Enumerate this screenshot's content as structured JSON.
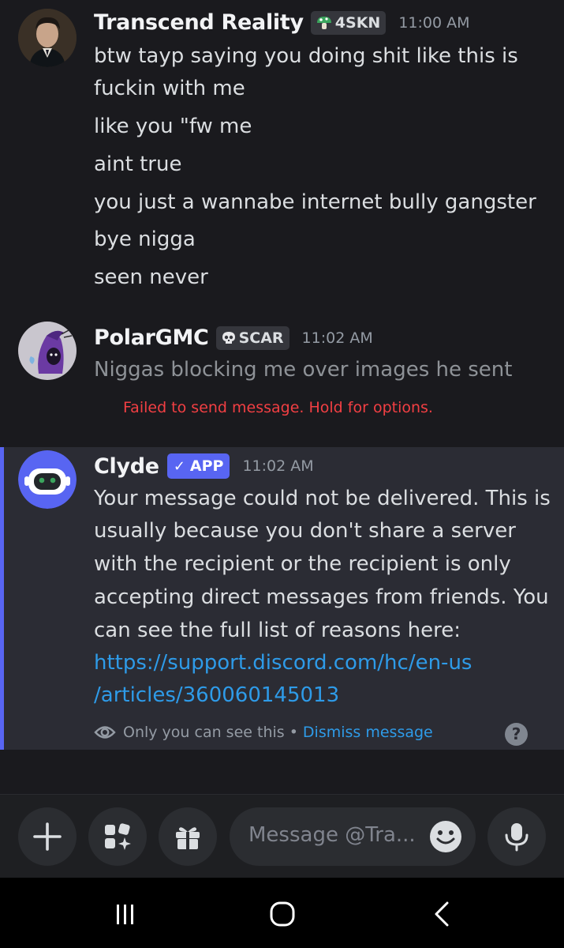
{
  "messages": [
    {
      "username": "Transcend Reality",
      "tag": "4SKN",
      "time": "11:00 AM",
      "lines": [
        "btw tayp saying you doing shit like this is",
        "fuckin with me",
        "like you \"fw me",
        "aint true",
        "you just a wannabe internet bully gangster",
        "bye nigga",
        "seen never"
      ]
    },
    {
      "username": "PolarGMC",
      "tag": "SCAR",
      "time": "11:02 AM",
      "lines": [
        "Niggas blocking me over images he sent"
      ],
      "error": "Failed to send message. Hold for options."
    }
  ],
  "clyde": {
    "username": "Clyde",
    "tag": "APP",
    "time": "11:02 AM",
    "lines": [
      "Your message could not be delivered. This is",
      "usually because you don't share a server",
      "with the recipient or the recipient is only",
      "accepting direct messages from friends. You",
      "can see the full list of reasons here:"
    ],
    "link_lines": [
      "https://support.discord.com/hc/en-us",
      "/articles/360060145013"
    ],
    "visibility_note": "Only you can see this •",
    "dismiss": "Dismiss message",
    "help": "?"
  },
  "composer": {
    "placeholder": "Message @Tra...",
    "buttons": [
      "plus-icon",
      "apps-icon",
      "gift-icon",
      "microphone-icon"
    ]
  },
  "navbar": {
    "buttons": [
      "recents-icon",
      "home-icon",
      "back-icon"
    ]
  },
  "colors": {
    "accent": "#5865f2",
    "link": "#2e9be8",
    "error": "#f23f43",
    "background": "#1a1a1e"
  }
}
